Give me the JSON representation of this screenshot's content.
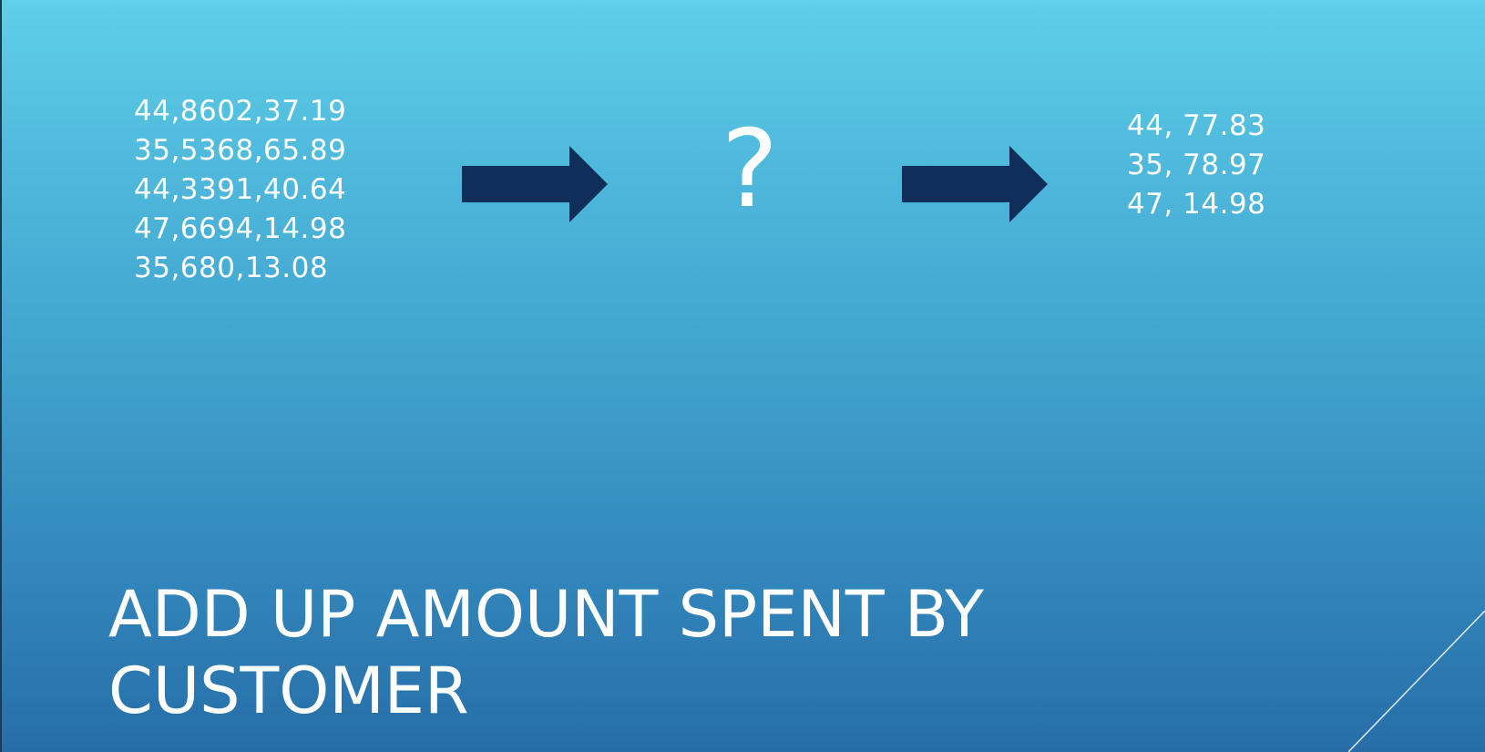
{
  "slide": {
    "input_lines": [
      "44,8602,37.19",
      "35,5368,65.89",
      "44,3391,40.64",
      "47,6694,14.98",
      "35,680,13.08"
    ],
    "question_mark": "?",
    "output_lines": [
      "44, 77.83",
      "35, 78.97",
      "47, 14.98"
    ],
    "title_line1": "ADD UP AMOUNT SPENT BY",
    "title_line2": "CUSTOMER"
  },
  "colors": {
    "background_top": "#5fd0e8",
    "background_bottom": "#276ea8",
    "arrow": "#0f2f5a",
    "text": "#ffffff"
  },
  "icons": {
    "arrow": "right-arrow-icon"
  }
}
